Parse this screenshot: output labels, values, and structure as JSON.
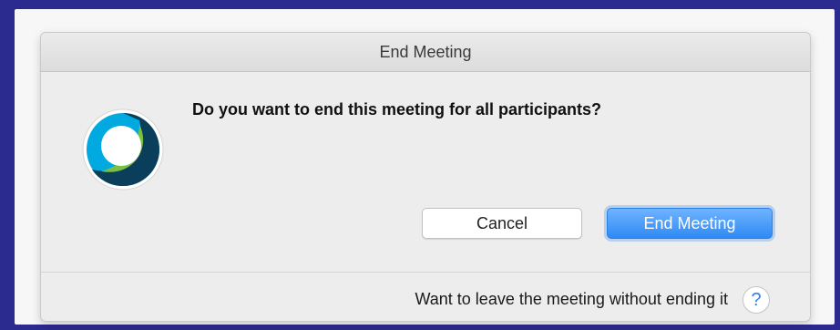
{
  "dialog": {
    "title": "End Meeting",
    "message": "Do you want to end this meeting for all participants?",
    "buttons": {
      "cancel_label": "Cancel",
      "end_label": "End Meeting"
    },
    "footer": {
      "text": "Want to leave the meeting without ending it",
      "help_glyph": "?"
    },
    "icon": "webex-logo-icon"
  },
  "colors": {
    "primary_button": "#2f8af4",
    "logo_teal": "#00a9e0",
    "logo_navy": "#0b3e5b",
    "logo_green": "#7ac143"
  }
}
